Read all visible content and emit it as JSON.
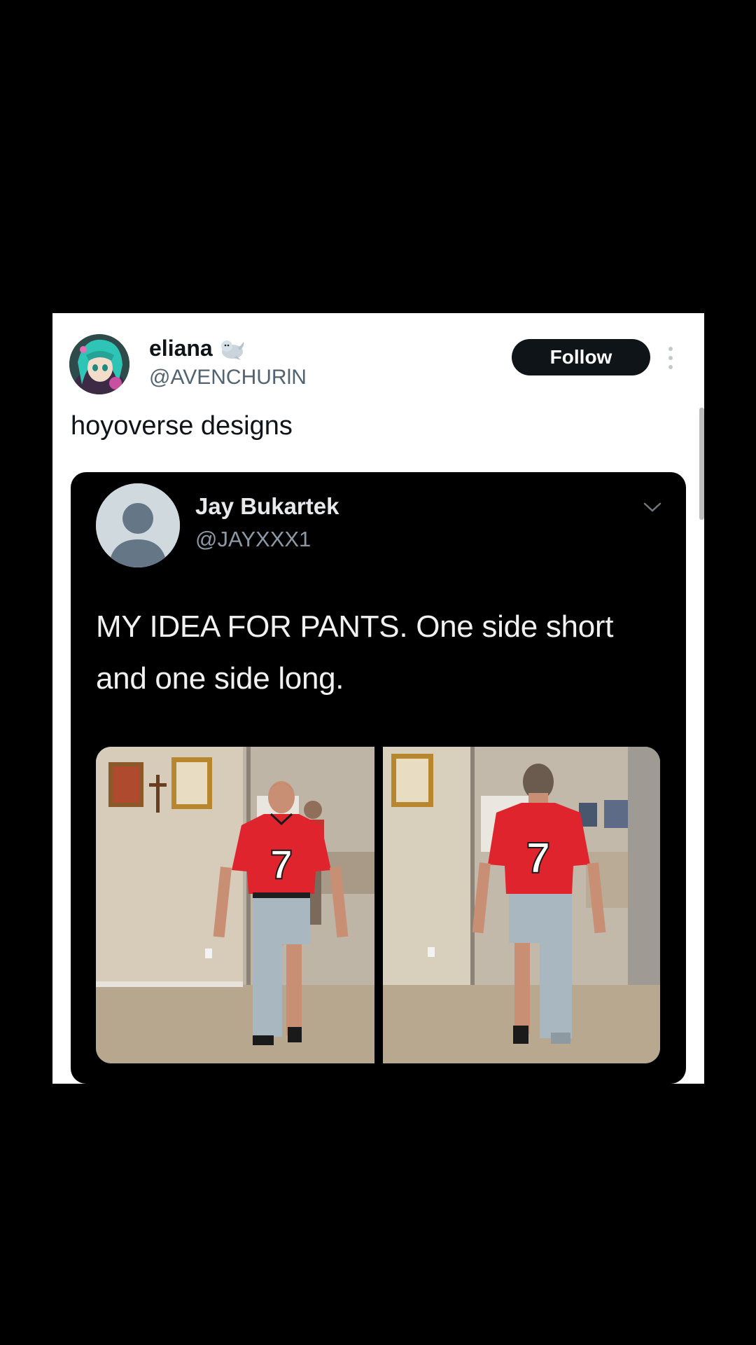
{
  "tweet": {
    "display_name": "eliana",
    "handle": "@AVENCHURlN",
    "follow_label": "Follow",
    "text": "hoyoverse designs"
  },
  "quoted_tweet": {
    "display_name": "Jay Bukartek",
    "handle": "@JAYXXX1",
    "text": "MY IDEA FOR PANTS. One side short and one side long.",
    "jersey_number": "7"
  },
  "icons": {
    "seal": "seal-emoji-icon",
    "more": "more-vertical-icon",
    "chevron": "chevron-down-icon",
    "default_avatar": "default-profile-icon"
  },
  "colors": {
    "background": "#000000",
    "card": "#ffffff",
    "follow_button": "#0f1419",
    "jersey": "#e0242d"
  }
}
